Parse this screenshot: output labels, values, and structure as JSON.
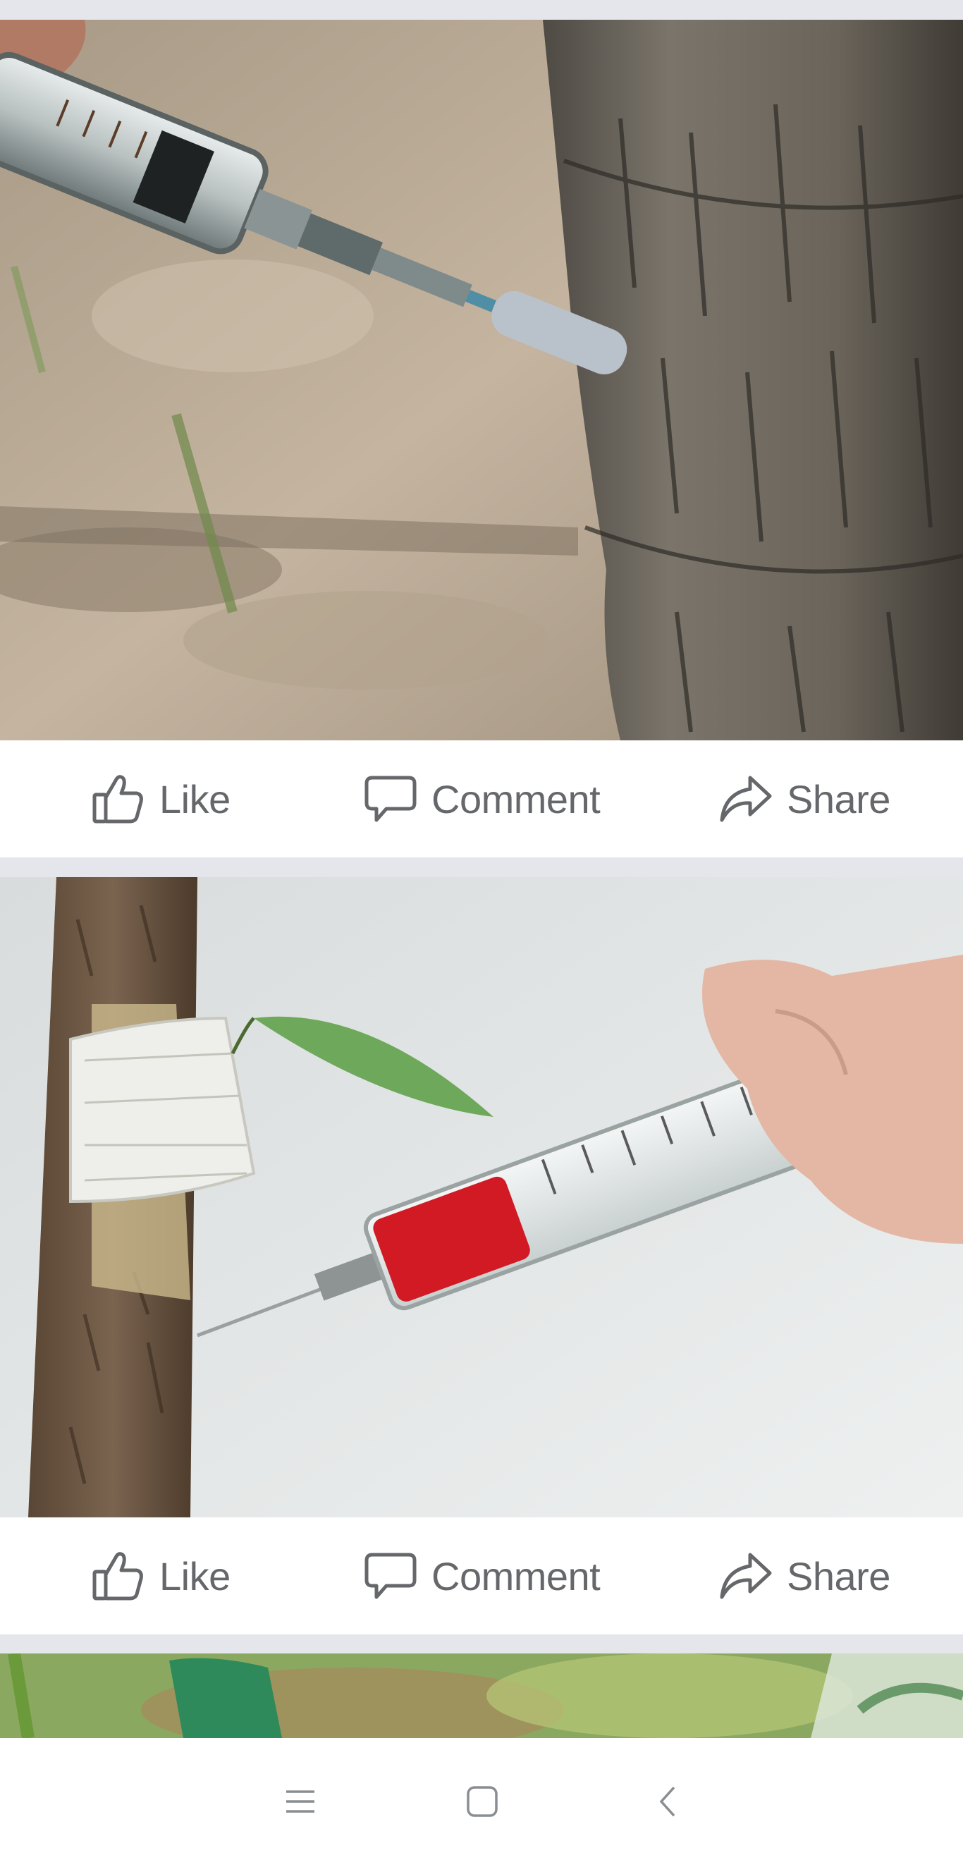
{
  "posts": [
    {
      "image": "syringe-injecting-palm-tree-trunk",
      "actions": {
        "like_label": "Like",
        "comment_label": "Comment",
        "share_label": "Share"
      }
    },
    {
      "image": "syringe-with-red-liquid-injecting-bandaged-sapling",
      "actions": {
        "like_label": "Like",
        "comment_label": "Comment",
        "share_label": "Share"
      }
    },
    {
      "image": "gloved-hand-in-green-foliage"
    }
  ],
  "navbar": {
    "buttons": [
      "menu-icon",
      "home-icon",
      "back-icon"
    ]
  },
  "colors": {
    "action_text": "#65676b",
    "separator": "#e4e6eb",
    "card_bg": "#ffffff"
  }
}
